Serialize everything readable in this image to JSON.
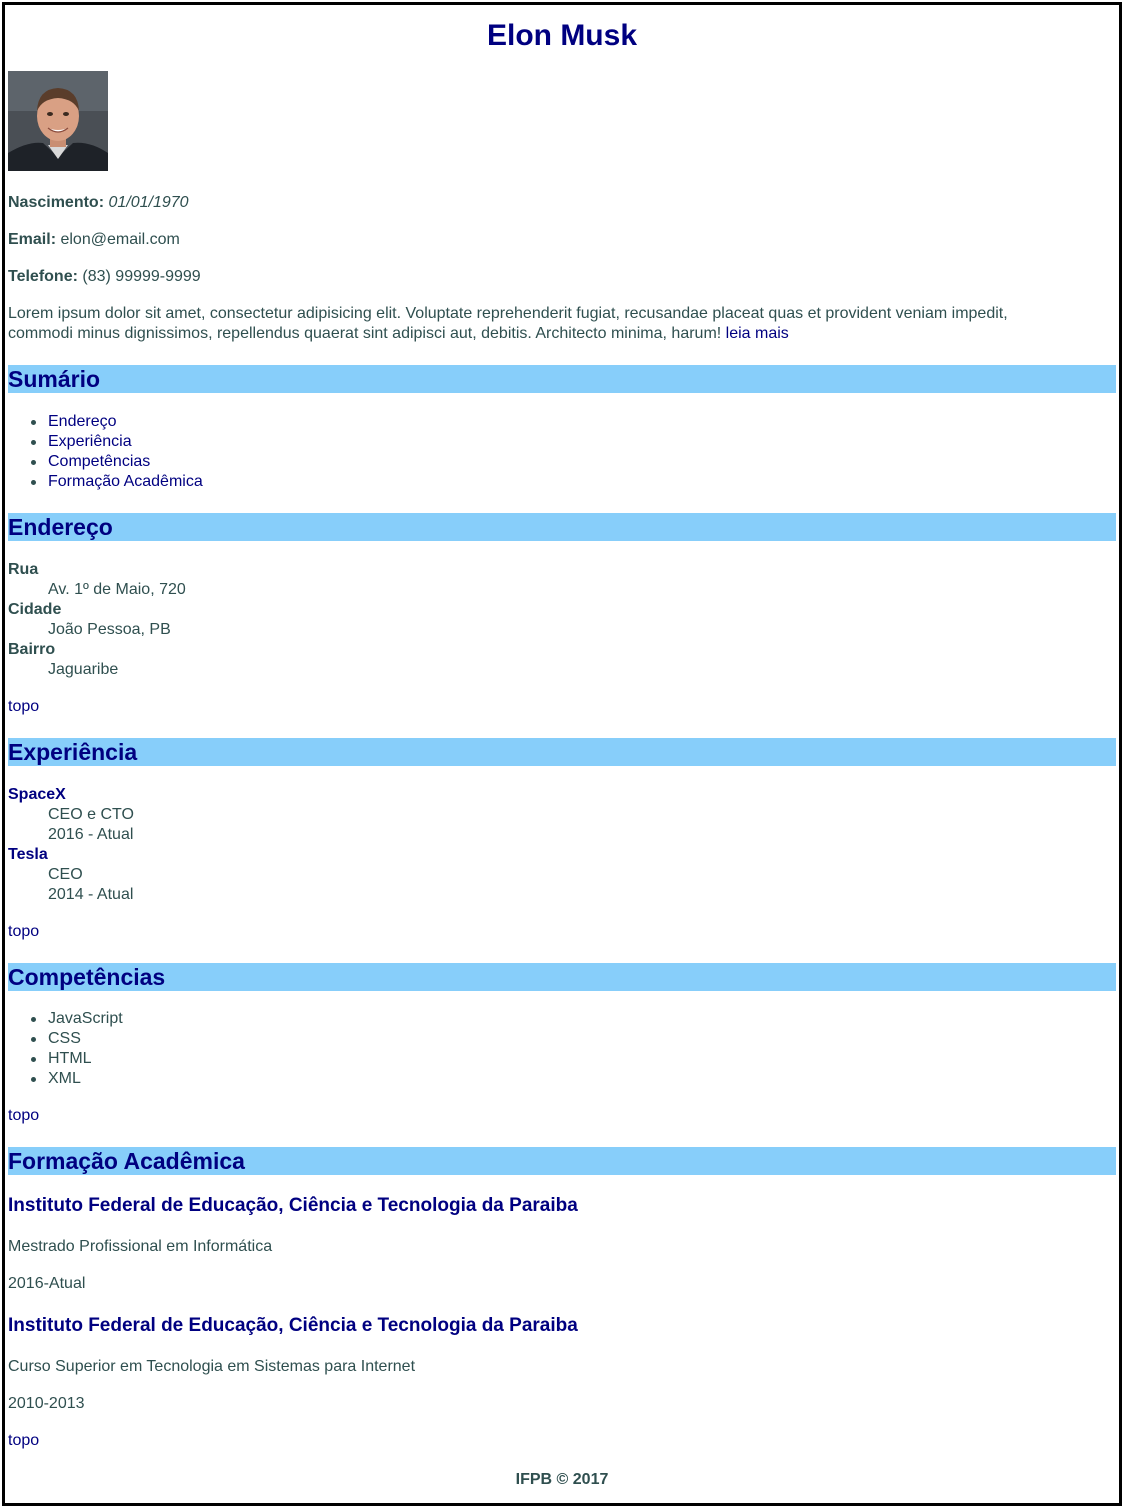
{
  "header": {
    "name": "Elon Musk"
  },
  "profile": {
    "birth_label": "Nascimento:",
    "birth_value": "01/01/1970",
    "email_label": "Email:",
    "email_value": "elon@email.com",
    "phone_label": "Telefone:",
    "phone_value": "(83) 99999-9999",
    "bio_line1": "Lorem ipsum dolor sit amet, consectetur adipisicing elit. Voluptate reprehenderit fugiat, recusandae placeat quas et provident veniam impedit,",
    "bio_line2": "commodi minus dignissimos, repellendus quaerat sint adipisci aut, debitis. Architecto minima, harum!",
    "read_more": "leia mais"
  },
  "summary": {
    "title": "Sumário",
    "items": [
      "Endereço",
      "Experiência",
      "Competências",
      "Formação Acadêmica"
    ]
  },
  "address": {
    "title": "Endereço",
    "street_label": "Rua",
    "street_value": "Av. 1º de Maio, 720",
    "city_label": "Cidade",
    "city_value": "João Pessoa, PB",
    "district_label": "Bairro",
    "district_value": "Jaguaribe",
    "top_link": "topo"
  },
  "experience": {
    "title": "Experiência",
    "jobs": [
      {
        "company": "SpaceX",
        "role": "CEO e CTO",
        "period": "2016 - Atual"
      },
      {
        "company": "Tesla",
        "role": "CEO",
        "period": "2014 - Atual"
      }
    ],
    "top_link": "topo"
  },
  "skills": {
    "title": "Competências",
    "items": [
      "JavaScript",
      "CSS",
      "HTML",
      "XML"
    ],
    "top_link": "topo"
  },
  "education": {
    "title": "Formação Acadêmica",
    "entries": [
      {
        "institution": "Instituto Federal de Educação, Ciência e Tecnologia da Paraiba",
        "course": "Mestrado Profissional em Informática",
        "period": "2016-Atual"
      },
      {
        "institution": "Instituto Federal de Educação, Ciência e Tecnologia da Paraiba",
        "course": "Curso Superior em Tecnologia em Sistemas para Internet",
        "period": "2010-2013"
      }
    ],
    "top_link": "topo"
  },
  "footer": {
    "text": "IFPB © 2017"
  },
  "colors": {
    "heading": "#000080",
    "section_bg": "#87cefa",
    "text": "#2f4f4f",
    "border": "#000000"
  },
  "icons": {
    "photo": "profile-photo-elon-musk"
  }
}
